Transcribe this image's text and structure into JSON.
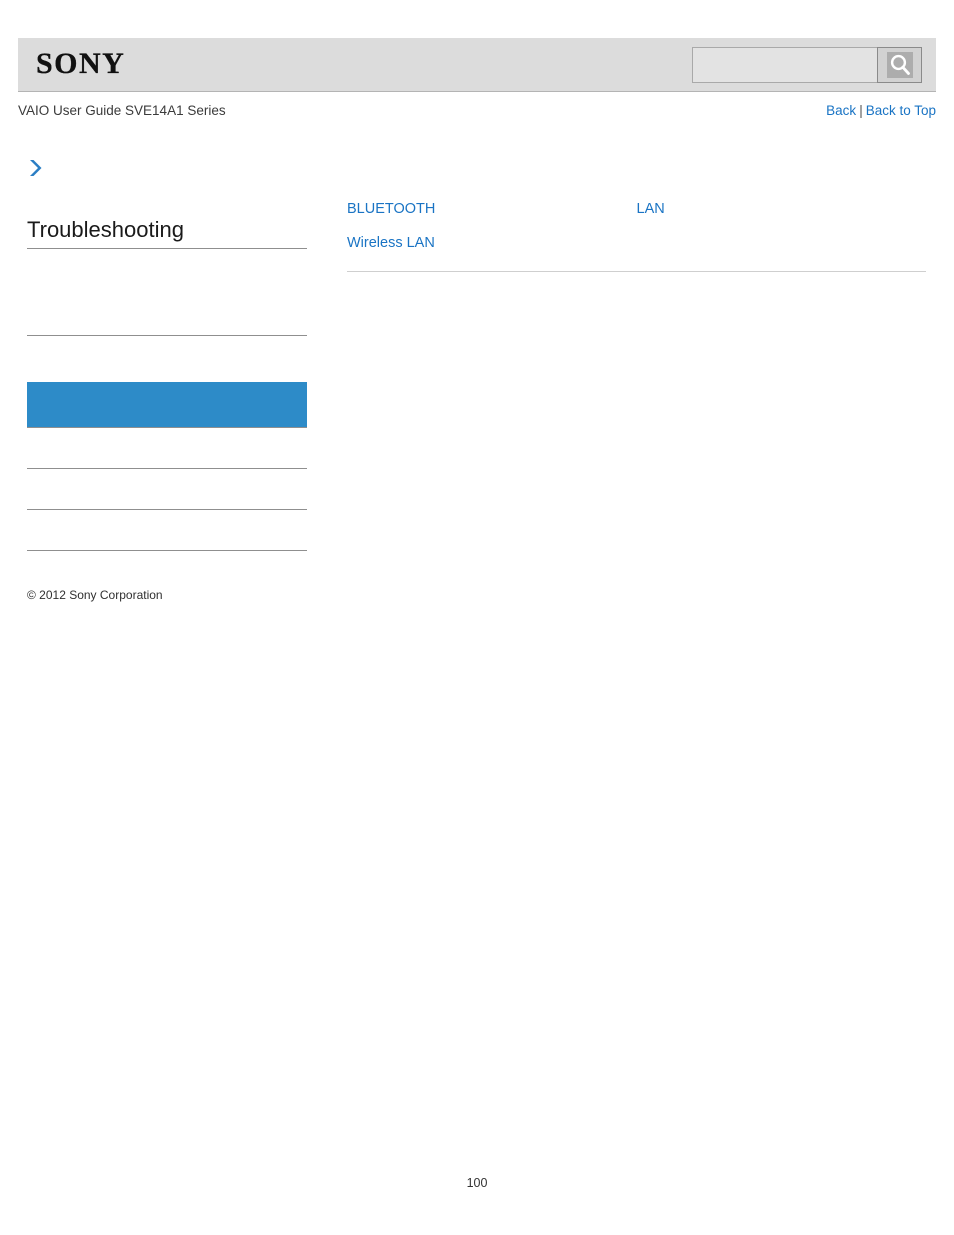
{
  "page": {
    "document_title": "VAIO User Guide SVE14A1 Series",
    "page_number": "100",
    "accent_color": "#1a74c4",
    "selected_color": "#2d8bc8",
    "header_bg": "#dcdcdc"
  },
  "header": {
    "logo_text": "SONY",
    "search": {
      "value": "",
      "placeholder": "",
      "button_icon": "search-icon"
    }
  },
  "subheader": {
    "guide_title": "VAIO User Guide SVE14A1 Series",
    "links": [
      {
        "label": "Back"
      },
      {
        "label": "Back to Top"
      }
    ],
    "separator": "|"
  },
  "sidebar": {
    "breadcrumb_icon": "chevron-right-icon",
    "title": "Troubleshooting",
    "items": [
      {
        "label": "",
        "selected": false,
        "divider": true
      },
      {
        "label": "",
        "selected": false,
        "divider": true
      },
      {
        "label": "",
        "selected": true,
        "divider": true
      },
      {
        "label": "",
        "selected": false,
        "divider": true
      },
      {
        "label": "",
        "selected": false,
        "divider": true
      },
      {
        "label": "",
        "selected": false,
        "divider": true
      }
    ],
    "copyright": "© 2012 Sony Corporation"
  },
  "content": {
    "links": [
      {
        "label": "BLUETOOTH"
      },
      {
        "label": "LAN"
      },
      {
        "label": "Wireless LAN"
      },
      {
        "label": ""
      }
    ]
  }
}
